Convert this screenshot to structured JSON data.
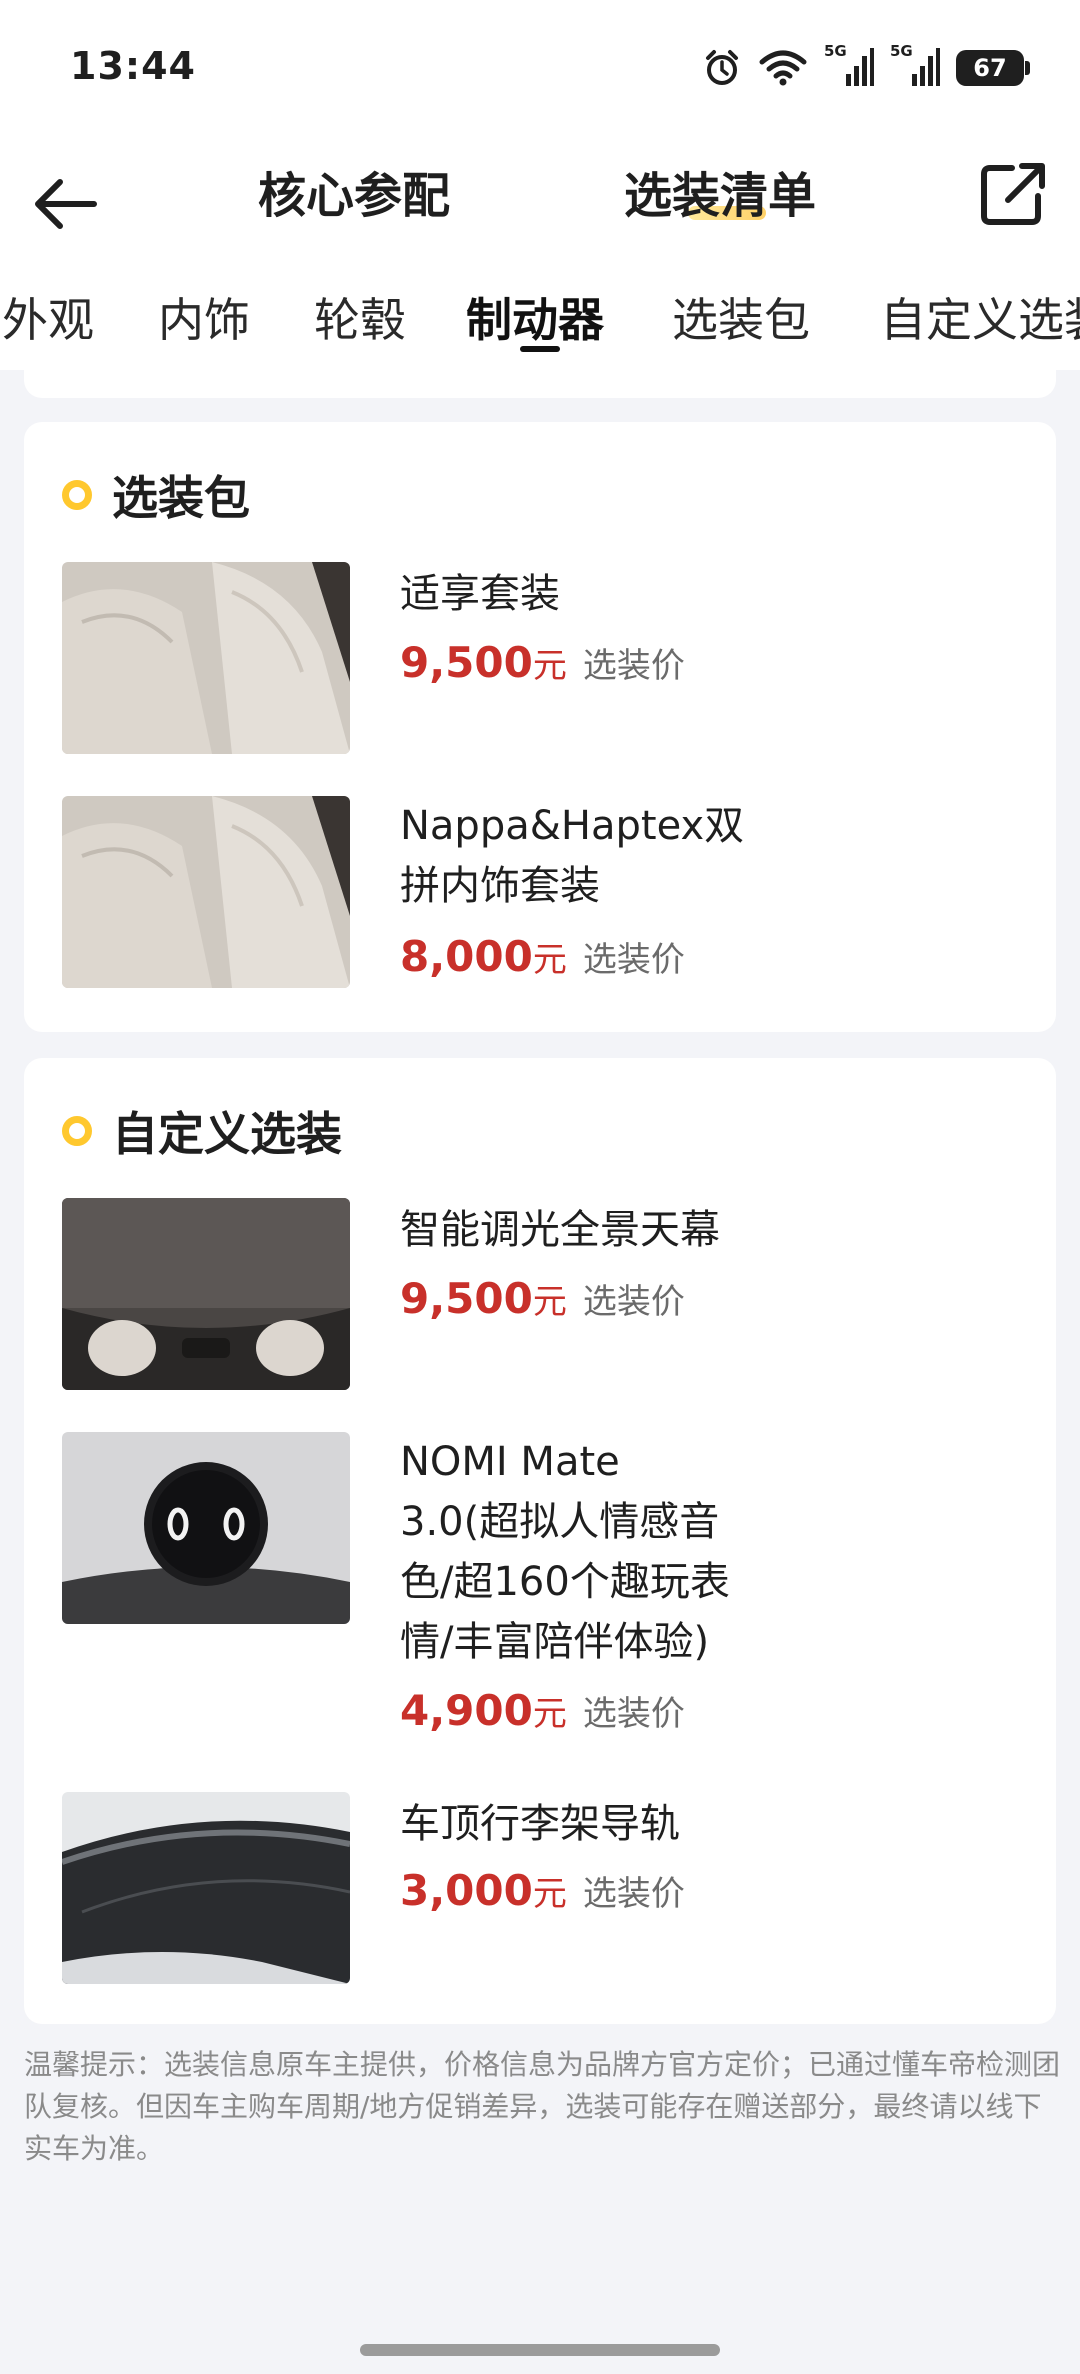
{
  "status_bar": {
    "time": "13:44",
    "battery": "67",
    "signal_1": "5G",
    "signal_2": "5G"
  },
  "header": {
    "tab_core": "核心参配",
    "tab_options": "选装清单"
  },
  "categories": [
    "外观",
    "内饰",
    "轮毂",
    "制动器",
    "选装包",
    "自定义选装"
  ],
  "active_category": "制动器",
  "sections": {
    "pack": {
      "title": "选装包",
      "items": [
        {
          "name": "适享套装",
          "price": "9,500",
          "unit": "元",
          "tag": "选装价"
        },
        {
          "name": "Nappa&Haptex双拼内饰套装",
          "price": "8,000",
          "unit": "元",
          "tag": "选装价"
        }
      ]
    },
    "custom": {
      "title": "自定义选装",
      "items": [
        {
          "name": "智能调光全景天幕",
          "price": "9,500",
          "unit": "元",
          "tag": "选装价"
        },
        {
          "name": "NOMI Mate 3.0(超拟人情感音色/超160个趣玩表情/丰富陪伴体验)",
          "price": "4,900",
          "unit": "元",
          "tag": "选装价"
        },
        {
          "name": "车顶行李架导轨",
          "price": "3,000",
          "unit": "元",
          "tag": "选装价"
        }
      ]
    }
  },
  "notice": "温馨提示：选装信息原车主提供，价格信息为品牌方官方定价；已通过懂车帝检测团队复核。但因车主购车周期/地方促销差异，选装可能存在赠送部分，最终请以线下实车为准。",
  "colors": {
    "price": "#c8302a",
    "accent_dot": "#ffc82e",
    "background": "#f3f4f8"
  }
}
